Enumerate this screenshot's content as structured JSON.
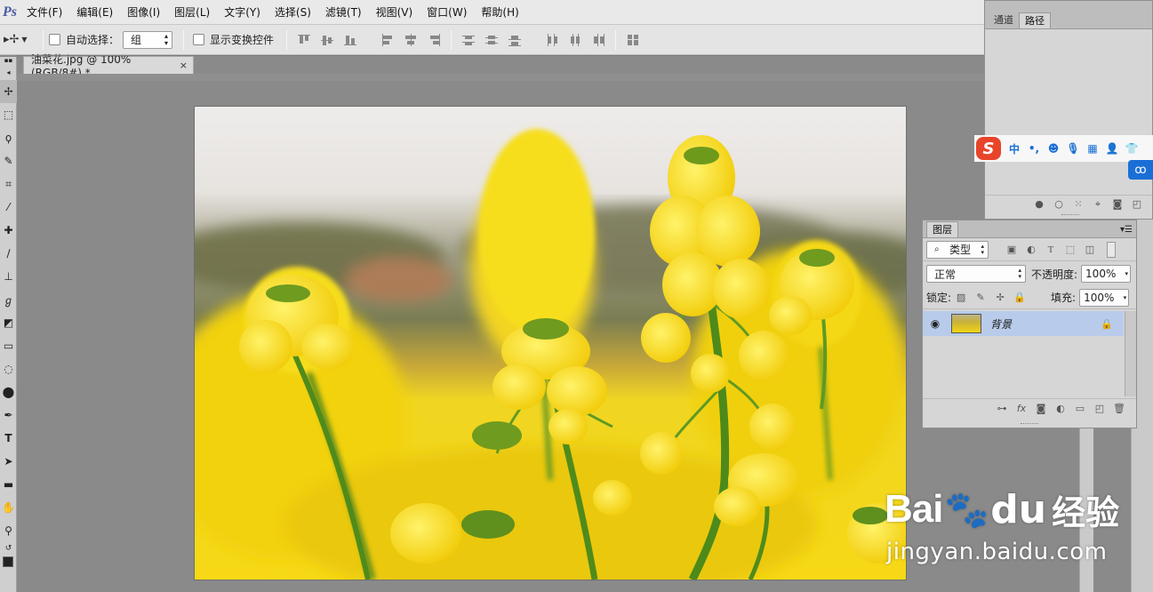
{
  "menu": {
    "logo": "Ps",
    "items": [
      "文件(F)",
      "编辑(E)",
      "图像(I)",
      "图层(L)",
      "文字(Y)",
      "选择(S)",
      "滤镜(T)",
      "视图(V)",
      "窗口(W)",
      "帮助(H)"
    ]
  },
  "options": {
    "auto_select_label": "自动选择：",
    "auto_select_value": "组",
    "show_transform_label": "显示变换控件"
  },
  "document": {
    "tab_title": "油菜花.jpg @ 100%(RGB/8#) *",
    "close": "×"
  },
  "channels_panel": {
    "tabs": [
      "通道",
      "路径"
    ],
    "active_tab": "路径"
  },
  "ime_toolbar": {
    "logo": "S",
    "mode": "中",
    "punct": "•,",
    "icons": [
      "emoji-icon",
      "mic-icon",
      "keyboard-icon",
      "user-icon",
      "shirt-icon"
    ]
  },
  "layers_panel": {
    "title": "图层",
    "filter_label": "类型",
    "blend_mode": "正常",
    "opacity_label": "不透明度:",
    "opacity_value": "100%",
    "lock_label": "锁定:",
    "fill_label": "填充:",
    "fill_value": "100%",
    "layers": [
      {
        "name": "背景",
        "visible": true,
        "locked": true,
        "selected": true
      }
    ],
    "footer_icons": [
      "link-icon",
      "fx-icon",
      "mask-icon",
      "adjustment-icon",
      "folder-icon",
      "new-layer-icon",
      "trash-icon"
    ]
  },
  "watermark": {
    "brand": "Bai",
    "brand2": "经验",
    "url": "jingyan.baidu.com"
  },
  "colors": {
    "accent": "#1a6fd6",
    "layer_selected": "#b8cbea",
    "ime_red": "#e8442a"
  }
}
